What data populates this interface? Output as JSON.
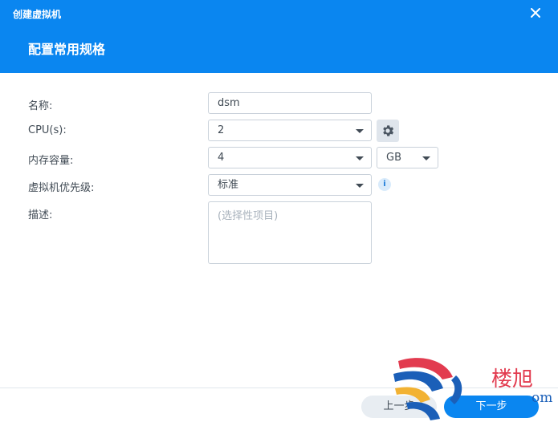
{
  "window": {
    "title": "创建虚拟机",
    "step_title": "配置常用规格"
  },
  "form": {
    "name_label": "名称:",
    "name_value": "dsm",
    "cpu_label": "CPU(s):",
    "cpu_value": "2",
    "memory_label": "内存容量:",
    "memory_value": "4",
    "memory_unit": "GB",
    "priority_label": "虚拟机优先级:",
    "priority_value": "标准",
    "description_label": "描述:",
    "description_placeholder": "(选择性项目)"
  },
  "footer": {
    "prev_label": "上一步",
    "next_label": "下一步"
  },
  "watermark": {
    "text": "楼旭",
    "partial_text": "om"
  },
  "colors": {
    "accent": "#0a86f0",
    "header_text": "#ffffff",
    "watermark_red": "#e23b4f"
  },
  "icons": {
    "close": "close-icon",
    "cpu_settings": "gear-icon",
    "priority_info": "info-icon",
    "dropdown": "chevron-down-icon"
  }
}
